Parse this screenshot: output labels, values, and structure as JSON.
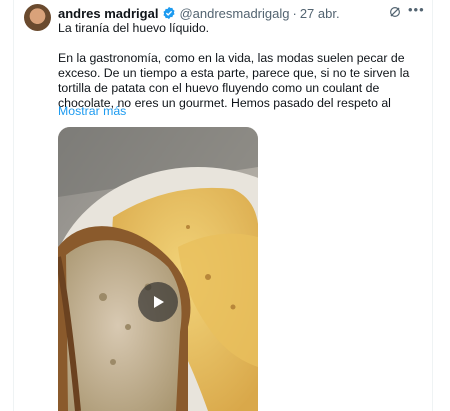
{
  "tweet": {
    "author_name": "andres madrigal",
    "handle": "@andresmadrigalg",
    "separator": "·",
    "date": "27 abr.",
    "text_line1": "La tiranía del huevo líquido.",
    "text_paragraph": "En la gastronomía, como en la vida, las modas suelen pecar de exceso. De un tiempo a esta parte, parece que, si no te sirven la tortilla de patata con el huevo fluyendo como un coulant de chocolate, no eres un gourmet. Hemos pasado del respeto al",
    "show_more": "Mostrar más"
  },
  "icons": {
    "verified": "verified-badge-icon",
    "grok": "grok-icon",
    "more": "more-options-icon",
    "play": "play-icon"
  },
  "colors": {
    "link": "#1d9bf0",
    "verified": "#1d9bf0",
    "secondary_text": "#536471"
  }
}
